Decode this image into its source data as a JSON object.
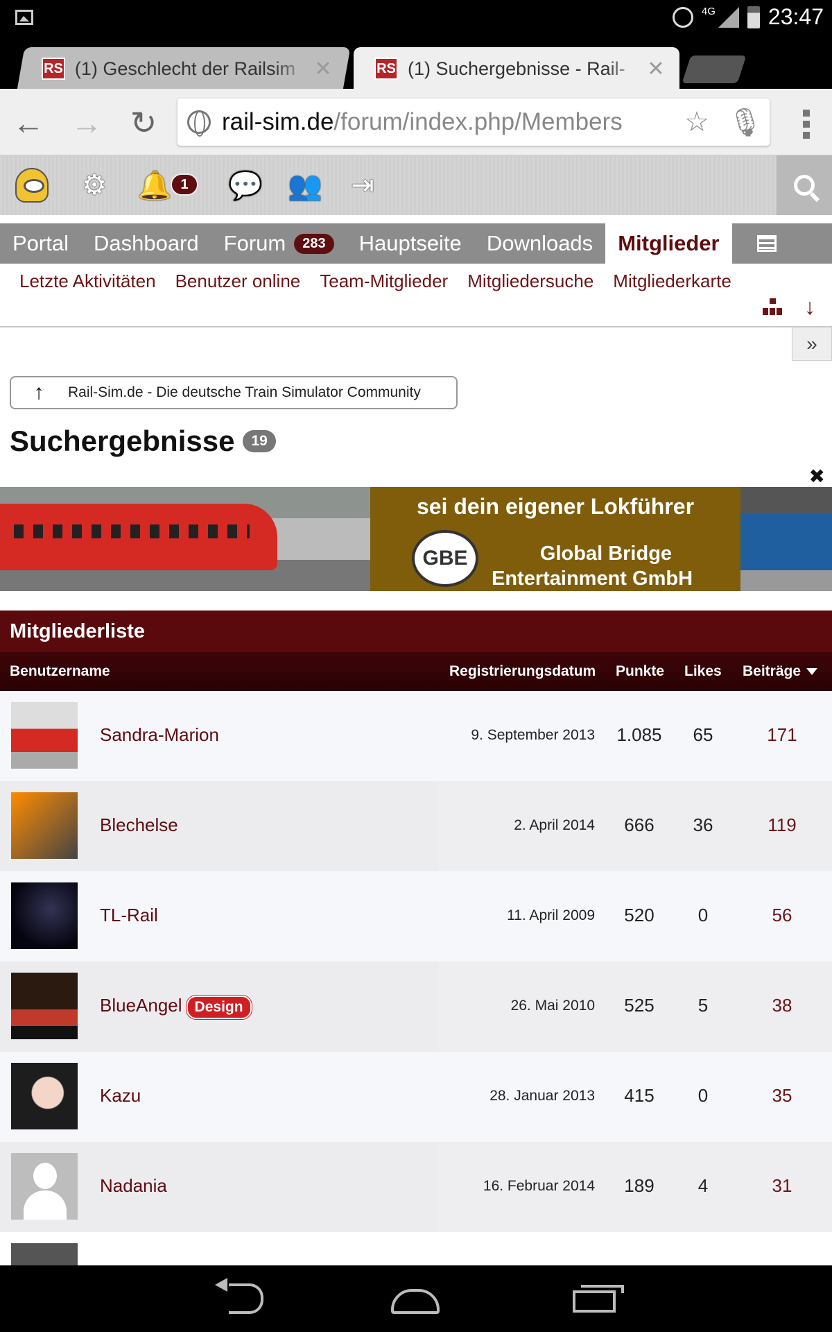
{
  "status_bar": {
    "network": "4G",
    "time": "23:47"
  },
  "browser": {
    "tabs": [
      {
        "label": "(1) Geschlecht der Railsim",
        "favicon": "RS",
        "active": false
      },
      {
        "label": "(1) Suchergebnisse - Rail-",
        "favicon": "RS",
        "active": true
      }
    ],
    "url_host": "rail-sim.de",
    "url_path": "/forum/index.php/Members"
  },
  "user_panel": {
    "notification_count": "1"
  },
  "main_nav": {
    "items": [
      {
        "label": "Portal"
      },
      {
        "label": "Dashboard"
      },
      {
        "label": "Forum",
        "badge": "283"
      },
      {
        "label": "Hauptseite"
      },
      {
        "label": "Downloads"
      },
      {
        "label": "Mitglieder",
        "active": true
      }
    ]
  },
  "sub_nav": {
    "items": [
      "Letzte Aktivitäten",
      "Benutzer online",
      "Team-Mitglieder",
      "Mitgliedersuche",
      "Mitgliederkarte"
    ]
  },
  "breadcrumb": {
    "label": "Rail-Sim.de - Die deutsche Train Simulator Community"
  },
  "page": {
    "title": "Suchergebnisse",
    "count": "19"
  },
  "banner": {
    "slogan": "sei dein eigener Lokführer",
    "logo_text": "GBE",
    "company_line1": "Global Bridge",
    "company_line2": "Entertainment GmbH"
  },
  "member_list": {
    "title": "Mitgliederliste",
    "columns": {
      "username": "Benutzername",
      "registered": "Registrierungsdatum",
      "points": "Punkte",
      "likes": "Likes",
      "posts": "Beiträge"
    },
    "rows": [
      {
        "name": "Sandra-Marion",
        "tag": "",
        "registered": "9. September 2013",
        "points": "1.085",
        "likes": "65",
        "posts": "171",
        "avatar": "train"
      },
      {
        "name": "Blechelse",
        "tag": "",
        "registered": "2. April 2014",
        "points": "666",
        "likes": "36",
        "posts": "119",
        "avatar": "wave"
      },
      {
        "name": "TL-Rail",
        "tag": "",
        "registered": "11. April 2009",
        "points": "520",
        "likes": "0",
        "posts": "56",
        "avatar": "dark"
      },
      {
        "name": "BlueAngel",
        "tag": "Design",
        "registered": "26. Mai 2010",
        "points": "525",
        "likes": "5",
        "posts": "38",
        "avatar": "night"
      },
      {
        "name": "Kazu",
        "tag": "",
        "registered": "28. Januar 2013",
        "points": "415",
        "likes": "0",
        "posts": "35",
        "avatar": "girl"
      },
      {
        "name": "Nadania",
        "tag": "",
        "registered": "16. Februar 2014",
        "points": "189",
        "likes": "4",
        "posts": "31",
        "avatar": "default"
      }
    ]
  },
  "colors": {
    "brand": "#5e0d10",
    "link": "#6d1417",
    "nav_bg": "#8c8c8c",
    "badge_red": "#d01f24"
  }
}
